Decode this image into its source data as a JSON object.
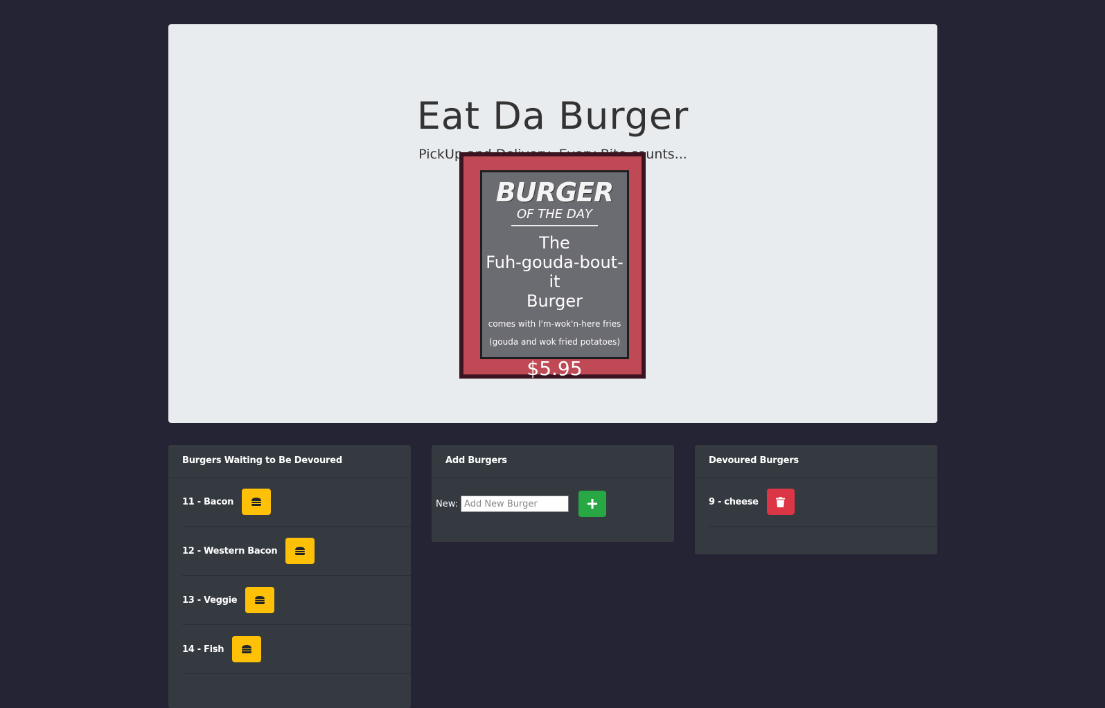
{
  "header": {
    "title": "Eat Da Burger",
    "subtitle": "PickUp and Delivery, Every Bite counts..."
  },
  "board": {
    "heading": "BURGER",
    "subheading": "OF THE DAY",
    "name_line1": "The",
    "name_line2": "Fuh-gouda-bout-it",
    "name_line3": "Burger",
    "desc_line1": "comes with I'm-wok'n-here fries",
    "desc_line2": "(gouda and wok fried potatoes)",
    "price": "$5.95"
  },
  "waiting": {
    "title": "Burgers Waiting to Be Devoured",
    "items": [
      {
        "label": "11 - Bacon"
      },
      {
        "label": "12 - Western Bacon"
      },
      {
        "label": "13 - Veggie"
      },
      {
        "label": "14 - Fish"
      }
    ]
  },
  "add": {
    "title": "Add Burgers",
    "label": "New:",
    "placeholder": "Add New Burger"
  },
  "devoured": {
    "title": "Devoured Burgers",
    "items": [
      {
        "label": "9 - cheese"
      }
    ]
  },
  "colors": {
    "background": "#242435",
    "devour_button": "#ffc107",
    "delete_button": "#dc3545",
    "add_button": "#28a745"
  }
}
